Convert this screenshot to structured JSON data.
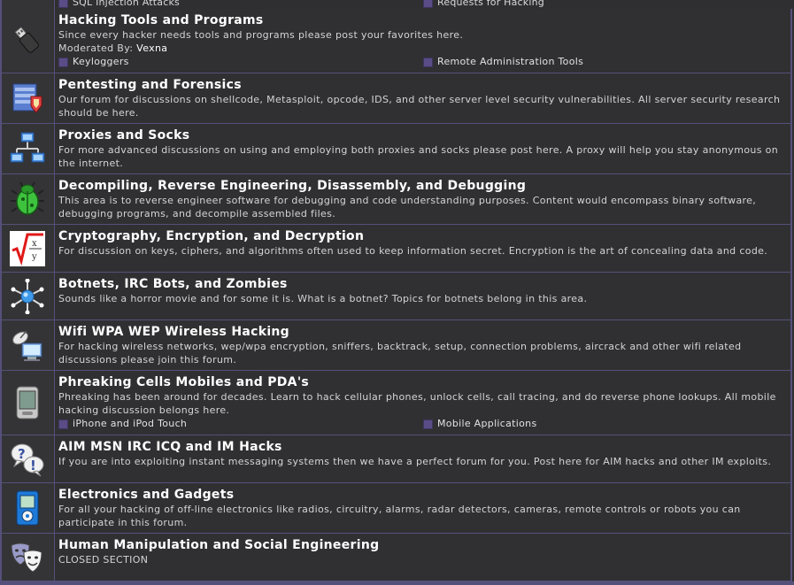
{
  "top_partial": {
    "subforums": [
      "SQL Injection Attacks",
      "Requests for Hacking"
    ]
  },
  "forums": [
    {
      "title": "Hacking Tools and Programs",
      "desc": "Since every hacker needs tools and programs please post your favorites here.",
      "mod_label": "Moderated By:",
      "moderator": "Vexna",
      "subforums": [
        "Keyloggers",
        "Remote Administration Tools"
      ],
      "icon": "usb-drive-icon"
    },
    {
      "title": "Pentesting and Forensics",
      "desc": "Our forum for discussions on shellcode, Metasploit, opcode, IDS, and other server level security vulnerabilities. All server security research should be here.",
      "icon": "server-shield-icon"
    },
    {
      "title": "Proxies and Socks",
      "desc": "For more advanced discussions on using and employing both proxies and socks please post here. A proxy will help you stay anonymous on the internet.",
      "icon": "network-computers-icon"
    },
    {
      "title": "Decompiling, Reverse Engineering, Disassembly, and Debugging",
      "desc": "This area is to reverse engineer software for debugging and code understanding purposes. Content would encompass binary software, debugging programs, and decompile assembled files.",
      "icon": "bug-icon"
    },
    {
      "title": "Cryptography, Encryption, and Decryption",
      "desc": "For discussion on keys, ciphers, and algorithms often used to keep information secret. Encryption is the art of concealing data and code.",
      "icon": "math-root-icon"
    },
    {
      "title": "Botnets, IRC Bots, and Zombies",
      "desc": "Sounds like a horror movie and for some it is. What is a botnet? Topics for botnets belong in this area.",
      "icon": "network-hub-icon"
    },
    {
      "title": "Wifi WPA WEP Wireless Hacking",
      "desc": "For hacking wireless networks, wep/wpa encryption, sniffers, backtrack, setup, connection problems, aircrack and other wifi related discussions please join this forum.",
      "icon": "satellite-computer-icon"
    },
    {
      "title": "Phreaking Cells Mobiles and PDA's",
      "desc": "Phreaking has been around for decades. Learn to hack cellular phones, unlock cells, call tracing, and do reverse phone lookups. All mobile hacking discussion belongs here.",
      "subforums": [
        "iPhone and iPod Touch",
        "Mobile Applications"
      ],
      "icon": "pda-icon"
    },
    {
      "title": "AIM MSN IRC ICQ and IM Hacks",
      "desc": "If you are into exploiting instant messaging systems then we have a perfect forum for you. Post here for AIM hacks and other IM exploits.",
      "icon": "chat-bubbles-icon"
    },
    {
      "title": "Electronics and Gadgets",
      "desc": "For all your hacking of off-line electronics like radios, circuitry, alarms, radar detectors, cameras, remote controls or robots you can participate in this forum.",
      "icon": "gadget-icon"
    },
    {
      "title": "Human Manipulation and Social Engineering",
      "desc": "CLOSED SECTION",
      "icon": "theater-masks-icon"
    }
  ]
}
